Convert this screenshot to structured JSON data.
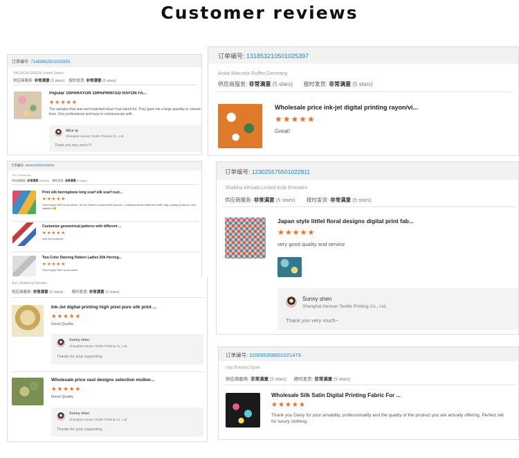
{
  "heading": "Customer reviews",
  "colors": {
    "accent_orange": "#f26a22",
    "link_blue": "#1c7dc7"
  },
  "card1": {
    "order_label": "订单编号:",
    "order_no": "71490962501025050",
    "buyer": "VALINCIA GREEN,United States",
    "supplier_label": "供应商服务:",
    "supplier_level": "非常满意",
    "supplier_stars": "(5 stars)",
    "ship_label": "按时发货:",
    "ship_level": "非常满意",
    "ship_stars": "(5 stars)",
    "product_title": "Popular 100%RAYON 100%PRINTED RAYON FA...",
    "stars": "★★★★★",
    "review": "The samples that was sent matched what I had asked for. They gave me a large quantity to choose from. Very professional and easy to communicate with.",
    "reply_name": "Alice qi",
    "reply_company": "Shanghai Hansun Textile Printing Co., Ltd.",
    "reply_msg": "Thank you very much !!!"
  },
  "card2": {
    "order_label": "订单编号:",
    "order_no": "131853210501025397",
    "buyer": "Anita Marcela Ruffer,Germany",
    "supplier_label": "供应商服务:",
    "supplier_level": "非常满意",
    "supplier_stars": "(5 stars)",
    "ship_label": "按时发货:",
    "ship_level": "非常满意",
    "ship_stars": "(5 stars)",
    "product_title": "Wholesale price ink-jet digital printing rayon/vi...",
    "stars": "★★★★★",
    "review": "Great!"
  },
  "card3": {
    "order_label": "订单编号:",
    "order_no": "55653420891028991",
    "buyer": "Tiso Sujatilongo",
    "supplier_label": "供应商服务:",
    "supplier_level": "非常满意",
    "supplier_stars": "(5 stars)",
    "ship_label": "按时发货:",
    "ship_level": "非常满意",
    "ship_stars": "(5 stars)",
    "items": [
      {
        "title": "Print silk herringbone long scarf silk scarf cust...",
        "stars": "★★★★★",
        "review": "Very happy with the products. Sunny Hansun customized scarves , professional and attentive staff, high quality products, very satisfied 😊"
      },
      {
        "title": "Customize geometrical patterns with different ...",
        "stars": "★★★★★",
        "review": "love the products"
      },
      {
        "title": "Two-Color Dancing Pattern Ladies Silk Herring...",
        "stars": "★★★★★",
        "review": "Very happy with my products"
      }
    ]
  },
  "card4": {
    "order_label": "订单编号:",
    "order_no": "123025575501022811",
    "buyer": "Shaikha AlKaabi,United Arab Emirates",
    "supplier_label": "供应商服务:",
    "supplier_level": "非常满意",
    "supplier_stars": "(5 stars)",
    "ship_label": "按时发货:",
    "ship_level": "非常满意",
    "ship_stars": "(5 stars)",
    "product_title": "Japan style littlel floral designs digital print fab...",
    "stars": "★★★★★",
    "review": "very good quality and service",
    "reply_name": "Sunny shen",
    "reply_company": "Shanghai Hansun Textile Printing Co., Ltd.",
    "reply_msg": "Thank you very much~"
  },
  "card5": {
    "buyer": "Sun Shatbeng,Sweden",
    "supplier_label": "供应商服务:",
    "supplier_level": "非常满意",
    "supplier_stars": "(5 stars)",
    "ship_label": "按时发货:",
    "ship_level": "非常满意",
    "ship_stars": "(5 stars)",
    "items": [
      {
        "title": "Ink-Jet digital printing high pixel pure silk print ...",
        "stars": "★★★★★",
        "review": "Good Quality",
        "reply_name": "Sunny shen",
        "reply_company": "Shanghai Hansun Textile Printing Co., Ltd.",
        "reply_msg": "Thanks for your supporting"
      },
      {
        "title": "Wholesale price vast designs selection mulber...",
        "stars": "★★★★★",
        "review": "Good Quality",
        "reply_name": "Sunny shen",
        "reply_company": "Shanghai Hansun Textile Printing Co., Ltd.",
        "reply_msg": "Thanks for your supporting"
      }
    ]
  },
  "card6": {
    "order_label": "订单编号:",
    "order_no": "110095358001021473",
    "buyer": "Ugo Boulard,Spain",
    "supplier_label": "供应商服务:",
    "supplier_level": "非常满意",
    "supplier_stars": "(5 stars)",
    "ship_label": "按时发货:",
    "ship_level": "非常满意",
    "ship_stars": "(5 stars)",
    "product_title": "Wholesale Silk Satin Digital Printing Fabric For ...",
    "stars": "★★★★★",
    "review": "Thank you Daisy for your amability, professionality and the quality of the product you are actually offering. Perfect silk for luxury clothing."
  }
}
